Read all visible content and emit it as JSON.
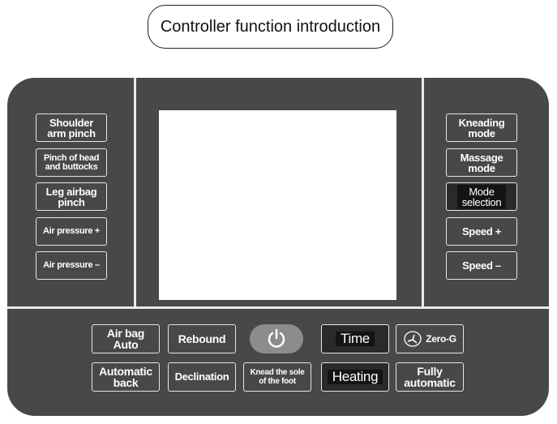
{
  "title": "Controller function introduction",
  "left_buttons": [
    "Shoulder\narm pinch",
    "Pinch of head\nand buttocks",
    "Leg airbag\npinch",
    "Air pressure +",
    "Air pressure –"
  ],
  "right_buttons": [
    "Kneading\nmode",
    "Massage\nmode",
    "Mode\nselection",
    "Speed +",
    "Speed –"
  ],
  "bottom_row1": [
    "Air bag\nAuto",
    "Rebound",
    "power-icon",
    "Time",
    "Zero-G"
  ],
  "bottom_row2": [
    "Automatic\nback",
    "Declination",
    "Knead the sole\nof the foot",
    "Heating",
    "Fully\nautomatic"
  ],
  "colors": {
    "panel": "#47484a",
    "highlight": "#141414",
    "power_button": "#8c8c8e"
  }
}
